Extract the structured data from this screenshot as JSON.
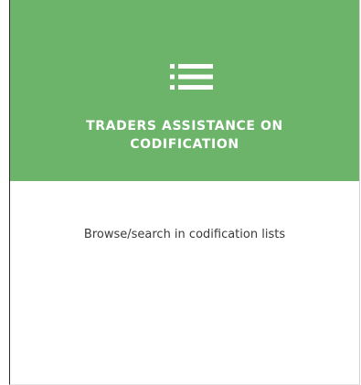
{
  "card": {
    "title_line1": "TRADERS ASSISTANCE ON",
    "title_line2": "CODIFICATION",
    "description": "Browse/search in codification lists",
    "icon": "list-icon",
    "header_color": "#6cb46a"
  }
}
